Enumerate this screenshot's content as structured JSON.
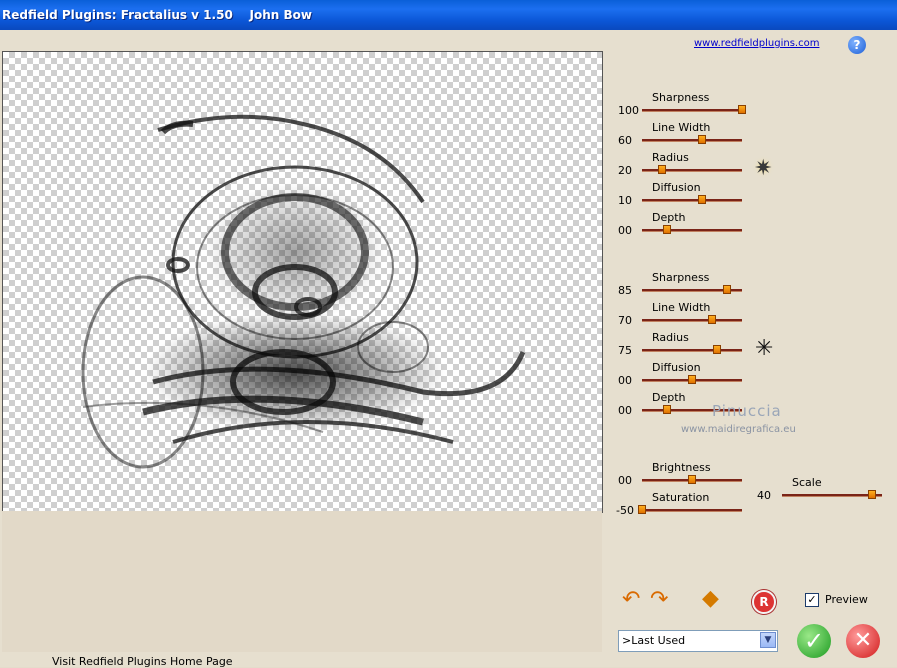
{
  "window": {
    "title": "Redfield Plugins: Fractalius v 1.50    John Bow"
  },
  "header": {
    "link": "www.redfieldplugins.com",
    "help_glyph": "?"
  },
  "group1": {
    "sharpness": {
      "label": "Sharpness",
      "value": "100",
      "level": 1.0
    },
    "line_width": {
      "label": "Line Width",
      "value": "60",
      "level": 0.6
    },
    "radius": {
      "label": "Radius",
      "value": "20",
      "level": 0.2
    },
    "diffusion": {
      "label": "Diffusion",
      "value": "10",
      "level": 0.6
    },
    "depth": {
      "label": "Depth",
      "value": "00",
      "level": 0.25
    }
  },
  "group2": {
    "sharpness": {
      "label": "Sharpness",
      "value": "85",
      "level": 0.85
    },
    "line_width": {
      "label": "Line Width",
      "value": "70",
      "level": 0.7
    },
    "radius": {
      "label": "Radius",
      "value": "75",
      "level": 0.75
    },
    "diffusion": {
      "label": "Diffusion",
      "value": "00",
      "level": 0.5
    },
    "depth": {
      "label": "Depth",
      "value": "00",
      "level": 0.25
    }
  },
  "adjust": {
    "brightness": {
      "label": "Brightness",
      "value": "00",
      "level": 0.5
    },
    "saturation": {
      "label": "Saturation",
      "value": "-50",
      "level": 0.0
    },
    "scale": {
      "label": "Scale",
      "value": "40",
      "level": 0.9
    }
  },
  "watermark": {
    "name": "Pinuccia",
    "site": "www.maidiregrafica.eu"
  },
  "toolbar": {
    "preview_label": "Preview",
    "preview_checked": true,
    "reg_glyph": "R"
  },
  "preset": {
    "selected": ">Last Used"
  },
  "footer": {
    "link": "Visit Redfield Plugins Home Page"
  },
  "colors": {
    "title_blue": "#0a5fd8",
    "slider_thumb": "#f08a00",
    "ok_green": "#1b9a20",
    "cancel_red": "#d11a1a"
  }
}
